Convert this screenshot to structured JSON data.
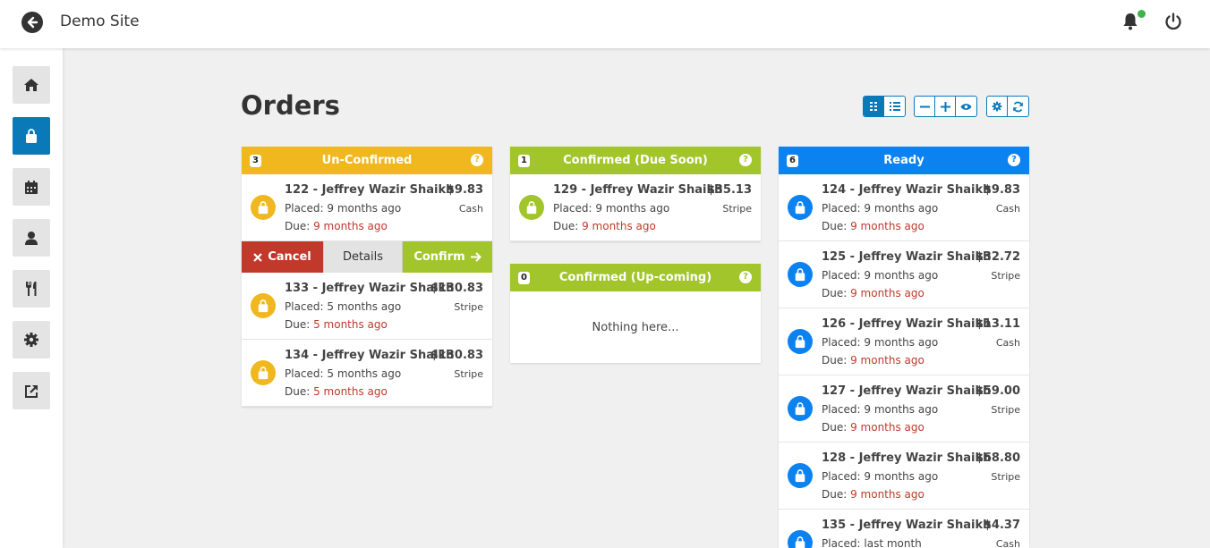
{
  "header": {
    "site_title": "Demo Site"
  },
  "page": {
    "title": "Orders"
  },
  "columns": [
    {
      "count": "3",
      "title": "Un-Confirmed",
      "color": "#f0b81e",
      "orders": [
        {
          "name": "122 - Jeffrey Wazir Shaikh",
          "price": "$9.83",
          "placed": "Placed: 9 months ago",
          "method": "Cash",
          "due_label": "Due: ",
          "due": "9 months ago"
        },
        {
          "name": "133 - Jeffrey Wazir Shaikh",
          "price": "$130.83",
          "placed": "Placed: 5 months ago",
          "method": "Stripe",
          "due_label": "Due: ",
          "due": "5 months ago"
        },
        {
          "name": "134 - Jeffrey Wazir Shaikh",
          "price": "$130.83",
          "placed": "Placed: 5 months ago",
          "method": "Stripe",
          "due_label": "Due: ",
          "due": "5 months ago"
        }
      ],
      "actions": {
        "cancel": "Cancel",
        "details": "Details",
        "confirm": "Confirm"
      }
    },
    {
      "count": "1",
      "title": "Confirmed (Due Soon)",
      "color": "#a2c52b",
      "orders": [
        {
          "name": "129 - Jeffrey Wazir Shaikh",
          "price": "$35.13",
          "placed": "Placed: 9 months ago",
          "method": "Stripe",
          "due_label": "Due: ",
          "due": "9 months ago"
        }
      ]
    },
    {
      "count": "0",
      "title": "Confirmed (Up-coming)",
      "color": "#a2c52b",
      "empty_text": "Nothing here..."
    },
    {
      "count": "6",
      "title": "Ready",
      "color": "#0b82f0",
      "orders": [
        {
          "name": "124 - Jeffrey Wazir Shaikh",
          "price": "$9.83",
          "placed": "Placed: 9 months ago",
          "method": "Cash",
          "due_label": "Due: ",
          "due": "9 months ago"
        },
        {
          "name": "125 - Jeffrey Wazir Shaikh",
          "price": "$32.72",
          "placed": "Placed: 9 months ago",
          "method": "Stripe",
          "due_label": "Due: ",
          "due": "9 months ago"
        },
        {
          "name": "126 - Jeffrey Wazir Shaikh",
          "price": "$13.11",
          "placed": "Placed: 9 months ago",
          "method": "Cash",
          "due_label": "Due: ",
          "due": "9 months ago"
        },
        {
          "name": "127 - Jeffrey Wazir Shaikh",
          "price": "$59.00",
          "placed": "Placed: 9 months ago",
          "method": "Stripe",
          "due_label": "Due: ",
          "due": "9 months ago"
        },
        {
          "name": "128 - Jeffrey Wazir Shaikh",
          "price": "$68.80",
          "placed": "Placed: 9 months ago",
          "method": "Stripe",
          "due_label": "Due: ",
          "due": "9 months ago"
        },
        {
          "name": "135 - Jeffrey Wazir Shaikh",
          "price": "$4.37",
          "placed": "Placed: last month",
          "method": "Cash"
        }
      ]
    }
  ],
  "help_glyph": "?",
  "sidebar_icons": [
    "home-icon",
    "shopping-bag-icon",
    "calendar-icon",
    "user-icon",
    "utensils-icon",
    "gear-icon",
    "external-link-icon"
  ]
}
